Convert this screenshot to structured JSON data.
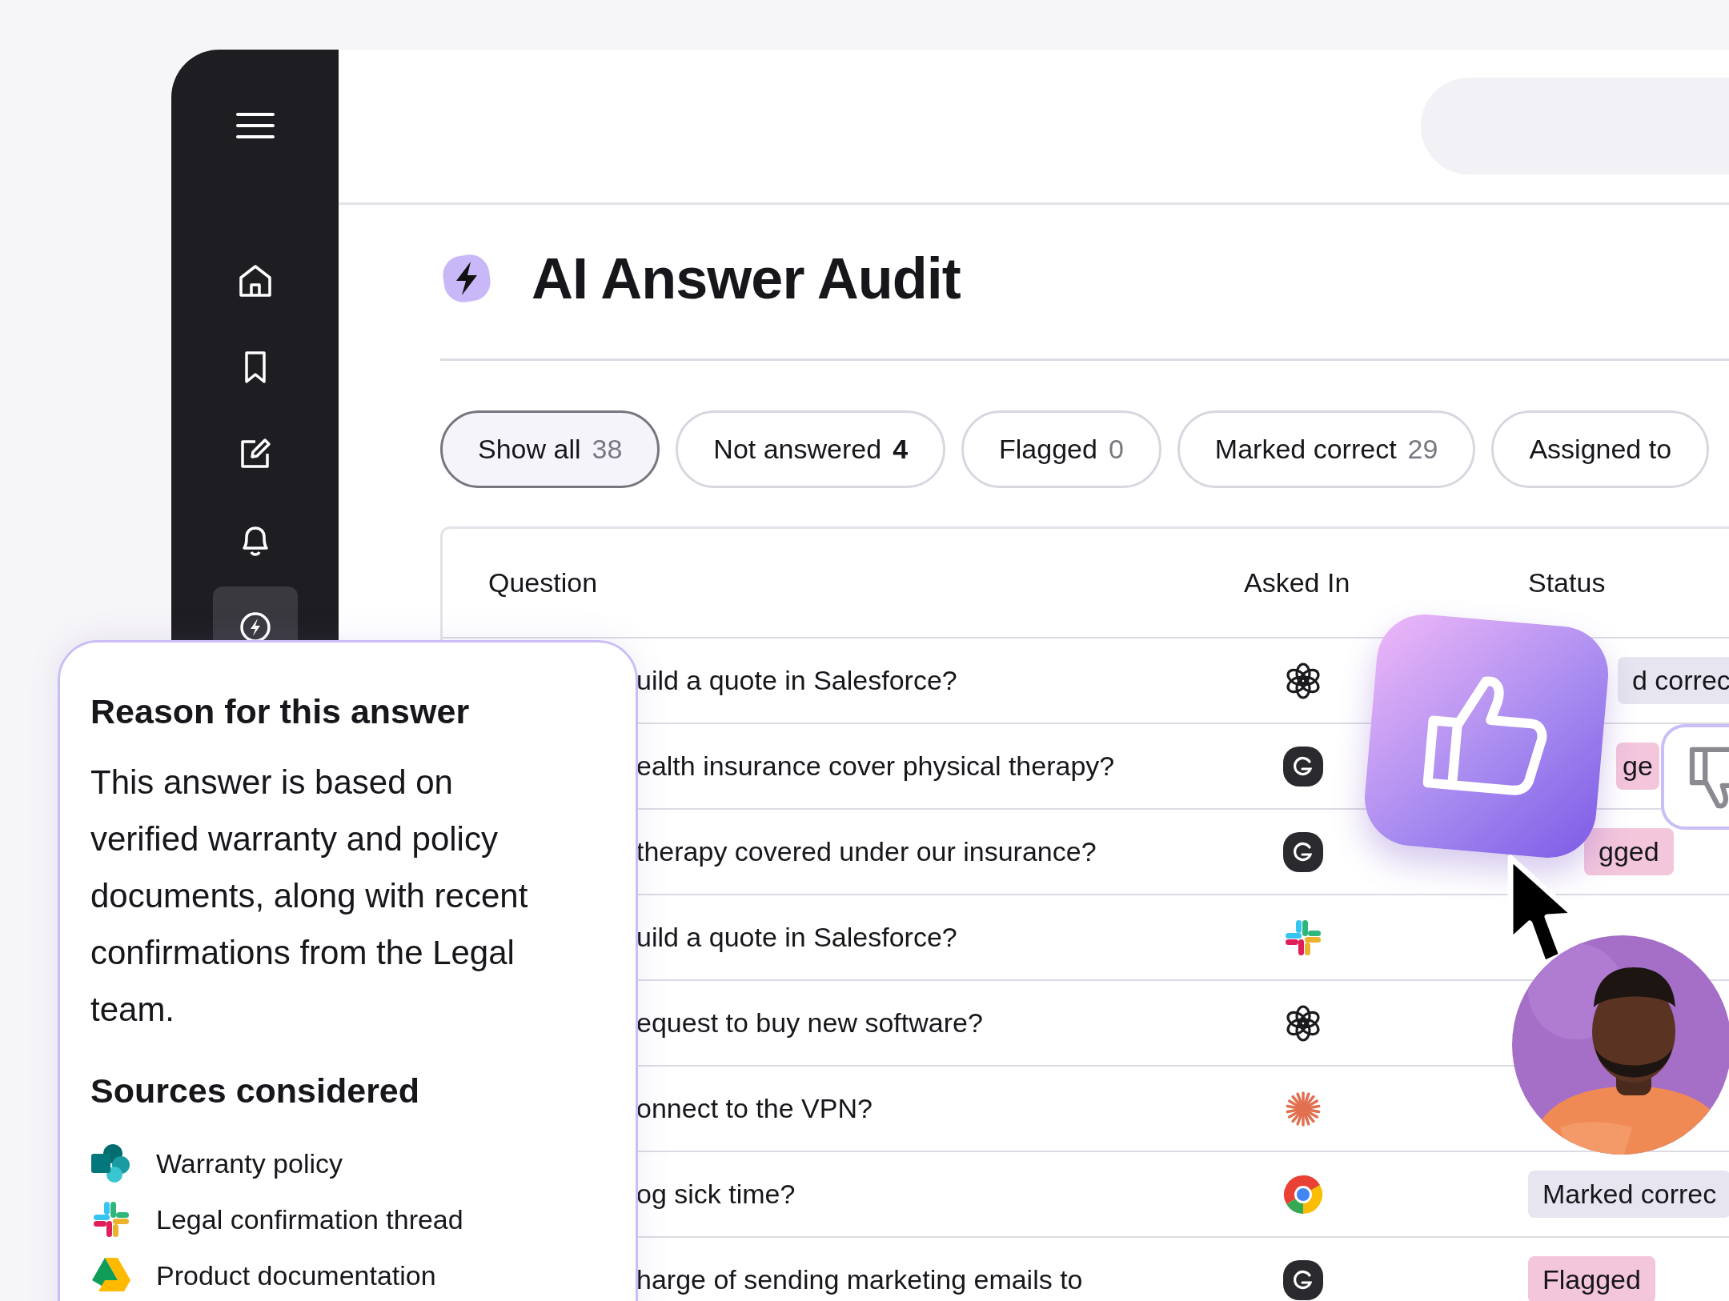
{
  "sidebar": {
    "items": [
      {
        "kind": "home",
        "selected": false
      },
      {
        "kind": "bookmark",
        "selected": false
      },
      {
        "kind": "edit",
        "selected": false
      },
      {
        "kind": "bell",
        "selected": false
      },
      {
        "kind": "bolt",
        "selected": true
      }
    ]
  },
  "page": {
    "title": "AI Answer Audit"
  },
  "filters": [
    {
      "label": "Show all",
      "count": "38",
      "selected": true,
      "emphasized": false
    },
    {
      "label": "Not answered",
      "count": "4",
      "selected": false,
      "emphasized": true
    },
    {
      "label": "Flagged",
      "count": "0",
      "selected": false,
      "emphasized": false
    },
    {
      "label": "Marked correct",
      "count": "29",
      "selected": false,
      "emphasized": false
    },
    {
      "label": "Assigned to",
      "selected": false
    }
  ],
  "table": {
    "columns": [
      "Question",
      "Asked In",
      "Status"
    ],
    "rows": [
      {
        "question": "uild a quote in Salesforce?",
        "kind": "openai",
        "status": {
          "text": "d correc",
          "kind": "correct"
        }
      },
      {
        "question": "ealth insurance cover physical therapy?",
        "kind": "dark",
        "status": {
          "text": "ge",
          "kind": "flagged"
        }
      },
      {
        "question": "therapy covered under our insurance?",
        "kind": "dark",
        "status": {
          "text": "gged",
          "kind": "flagged"
        }
      },
      {
        "question": "uild a quote in Salesforce?",
        "kind": "slack"
      },
      {
        "question": "equest to buy new software?",
        "kind": "openai"
      },
      {
        "question": "onnect to the VPN?",
        "kind": "claude"
      },
      {
        "question": "og sick time?",
        "kind": "chrome",
        "status": {
          "text": "Marked correc",
          "kind": "correct"
        }
      },
      {
        "question": "harge of sending marketing emails to",
        "kind": "dark",
        "status": {
          "text": "Flagged",
          "kind": "flagged"
        }
      }
    ]
  },
  "reason_panel": {
    "title": "Reason for this answer",
    "body": "This answer is based on verified warranty and policy documents, along with recent confirmations from the Legal team.",
    "sources_title": "Sources considered",
    "sources": [
      {
        "label": "Warranty policy",
        "kind": "sharepoint"
      },
      {
        "label": "Legal confirmation thread",
        "kind": "slack"
      },
      {
        "label": "Product documentation",
        "kind": "drive"
      }
    ]
  },
  "feedback": [
    {
      "kind": "up",
      "selected": true
    },
    {
      "kind": "down",
      "selected": false
    }
  ]
}
